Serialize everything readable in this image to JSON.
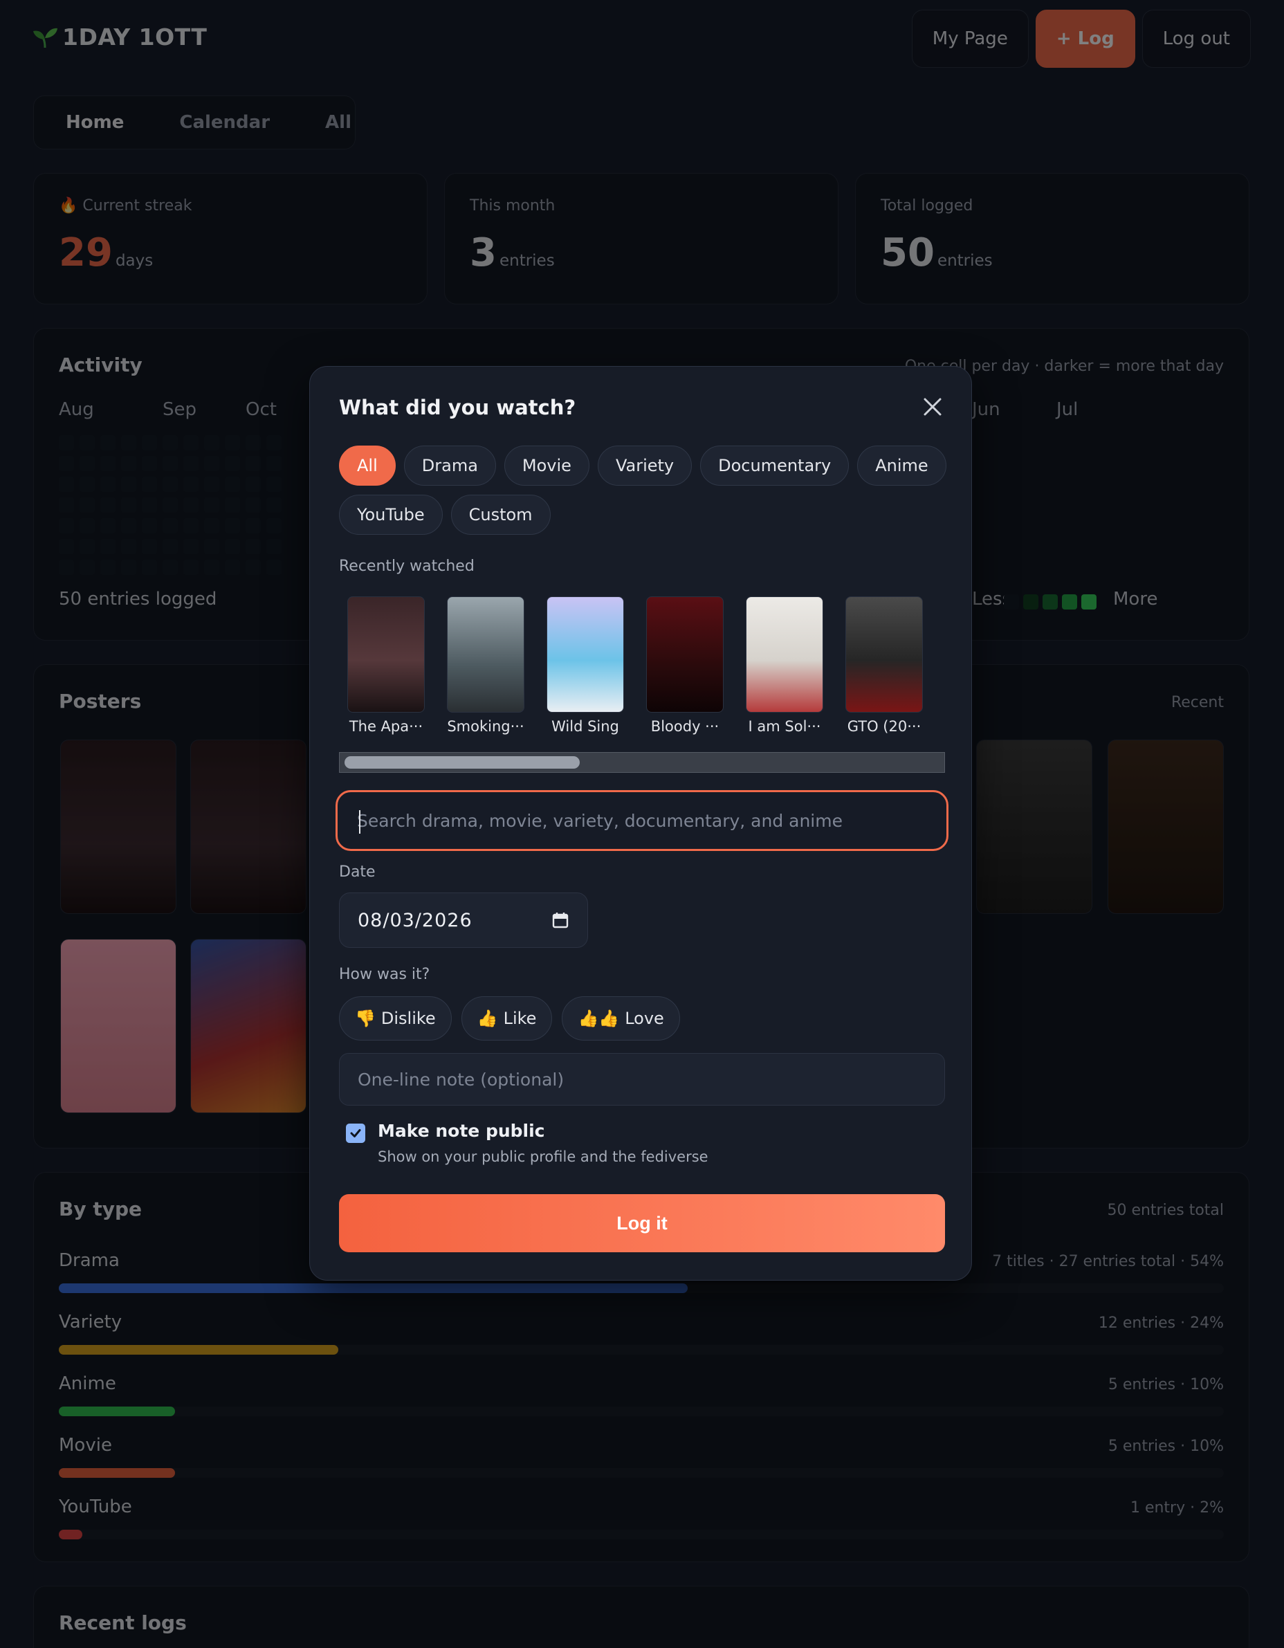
{
  "app": {
    "title": "1DAY 1OTT"
  },
  "header": {
    "my_page": "My Page",
    "log": "+ Log",
    "logout": "Log out"
  },
  "tabs": [
    "Home",
    "Calendar",
    "All"
  ],
  "stats": {
    "streak": {
      "label": "Current streak",
      "value": "29",
      "unit": "days"
    },
    "month": {
      "label": "This month",
      "value": "3",
      "unit": "entries"
    },
    "total": {
      "label": "Total logged",
      "value": "50",
      "unit": "entries"
    }
  },
  "activity": {
    "title": "Activity",
    "note": "One cell per day · darker = more that day",
    "months": [
      "Aug",
      "Sep",
      "Oct",
      "Jun",
      "Jul"
    ],
    "footer": "50 entries logged",
    "legend_less": "Less",
    "legend_more": "More"
  },
  "posters": {
    "title": "Posters",
    "note": "Recent"
  },
  "by_type": {
    "title": "By type",
    "total": "50 entries total",
    "rows": [
      {
        "name": "Drama",
        "value": "7 titles · 27 entries total · 54%",
        "pct": 54,
        "color": "#3a6fe0"
      },
      {
        "name": "Variety",
        "value": "12 entries · 24%",
        "pct": 24,
        "color": "#d8a21e"
      },
      {
        "name": "Anime",
        "value": "5 entries · 10%",
        "pct": 10,
        "color": "#2fbf4f"
      },
      {
        "name": "Movie",
        "value": "5 entries · 10%",
        "pct": 10,
        "color": "#e8613d"
      },
      {
        "name": "YouTube",
        "value": "1 entry · 2%",
        "pct": 2,
        "color": "#e04545"
      }
    ]
  },
  "recent_logs": {
    "title": "Recent logs"
  },
  "modal": {
    "title": "What did you watch?",
    "chips": [
      "All",
      "Drama",
      "Movie",
      "Variety",
      "Documentary",
      "Anime",
      "YouTube",
      "Custom"
    ],
    "recently_label": "Recently watched",
    "recent": [
      "The Apa···",
      "Smoking···",
      "Wild Sing",
      "Bloody ···",
      "I am Sol···",
      "GTO (20···"
    ],
    "search_placeholder": "Search drama, movie, variety, documentary, and anime",
    "date_label": "Date",
    "date_value": "08/03/2026",
    "rating_label": "How was it?",
    "ratings": [
      {
        "emoji": "👎",
        "label": "Dislike"
      },
      {
        "emoji": "👍",
        "label": "Like"
      },
      {
        "emoji": "👍👍",
        "label": "Love"
      }
    ],
    "note_placeholder": "One-line note (optional)",
    "public_label": "Make note public",
    "public_sub": "Show on your public profile and the fediverse",
    "submit": "Log it"
  },
  "colors": {
    "accent": "#f06a4a",
    "background": "#0b0e15",
    "panel": "#171c27"
  }
}
